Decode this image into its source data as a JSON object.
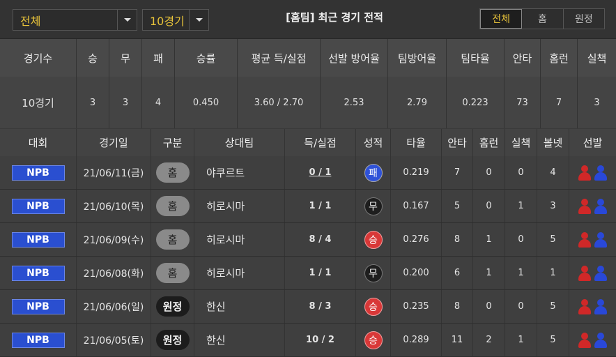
{
  "filters": {
    "league_select": "전체",
    "games_select": "10경기"
  },
  "title": "[홈팀] 최근 경기 전적",
  "tabs": [
    {
      "label": "전체",
      "active": true
    },
    {
      "label": "홈",
      "active": false
    },
    {
      "label": "원정",
      "active": false
    }
  ],
  "summary": {
    "headers": [
      "경기수",
      "승",
      "무",
      "패",
      "승률",
      "평균 득/실점",
      "선발 방어율",
      "팀방어율",
      "팀타율",
      "안타",
      "홈런",
      "실책"
    ],
    "values": [
      "10경기",
      "3",
      "3",
      "4",
      "0.450",
      "3.60 / 2.70",
      "2.53",
      "2.79",
      "0.223",
      "73",
      "7",
      "3"
    ]
  },
  "games": {
    "headers": [
      "대회",
      "경기일",
      "구분",
      "상대팀",
      "득/실점",
      "성적",
      "타율",
      "안타",
      "홈런",
      "실책",
      "볼넷",
      "선발"
    ],
    "rows": [
      {
        "league": "NPB",
        "date": "21/06/11(금)",
        "venue": "홈",
        "venue_type": "home",
        "opponent": "야쿠르트",
        "score": "0 / 1",
        "result": "패",
        "result_type": "loss",
        "avg": "0.219",
        "hits": "7",
        "hr": "0",
        "errors": "0",
        "walks": "4"
      },
      {
        "league": "NPB",
        "date": "21/06/10(목)",
        "venue": "홈",
        "venue_type": "home",
        "opponent": "히로시마",
        "score": "1 / 1",
        "result": "무",
        "result_type": "draw",
        "avg": "0.167",
        "hits": "5",
        "hr": "0",
        "errors": "1",
        "walks": "3"
      },
      {
        "league": "NPB",
        "date": "21/06/09(수)",
        "venue": "홈",
        "venue_type": "home",
        "opponent": "히로시마",
        "score": "8 / 4",
        "result": "승",
        "result_type": "win",
        "avg": "0.276",
        "hits": "8",
        "hr": "1",
        "errors": "0",
        "walks": "5"
      },
      {
        "league": "NPB",
        "date": "21/06/08(화)",
        "venue": "홈",
        "venue_type": "home",
        "opponent": "히로시마",
        "score": "1 / 1",
        "result": "무",
        "result_type": "draw",
        "avg": "0.200",
        "hits": "6",
        "hr": "1",
        "errors": "1",
        "walks": "1"
      },
      {
        "league": "NPB",
        "date": "21/06/06(일)",
        "venue": "원정",
        "venue_type": "away",
        "opponent": "한신",
        "score": "8 / 3",
        "result": "승",
        "result_type": "win",
        "avg": "0.235",
        "hits": "8",
        "hr": "0",
        "errors": "0",
        "walks": "5"
      },
      {
        "league": "NPB",
        "date": "21/06/05(토)",
        "venue": "원정",
        "venue_type": "away",
        "opponent": "한신",
        "score": "10 / 2",
        "result": "승",
        "result_type": "win",
        "avg": "0.289",
        "hits": "11",
        "hr": "2",
        "errors": "1",
        "walks": "5"
      }
    ]
  },
  "icons": {
    "pitcher_home": "home-pitcher-icon",
    "pitcher_away": "away-pitcher-icon"
  },
  "colors": {
    "accent": "#e8c33a",
    "league_badge": "#2a4fd0",
    "win": "#d93838",
    "loss": "#2f52d8",
    "draw": "#1e1e1e"
  }
}
